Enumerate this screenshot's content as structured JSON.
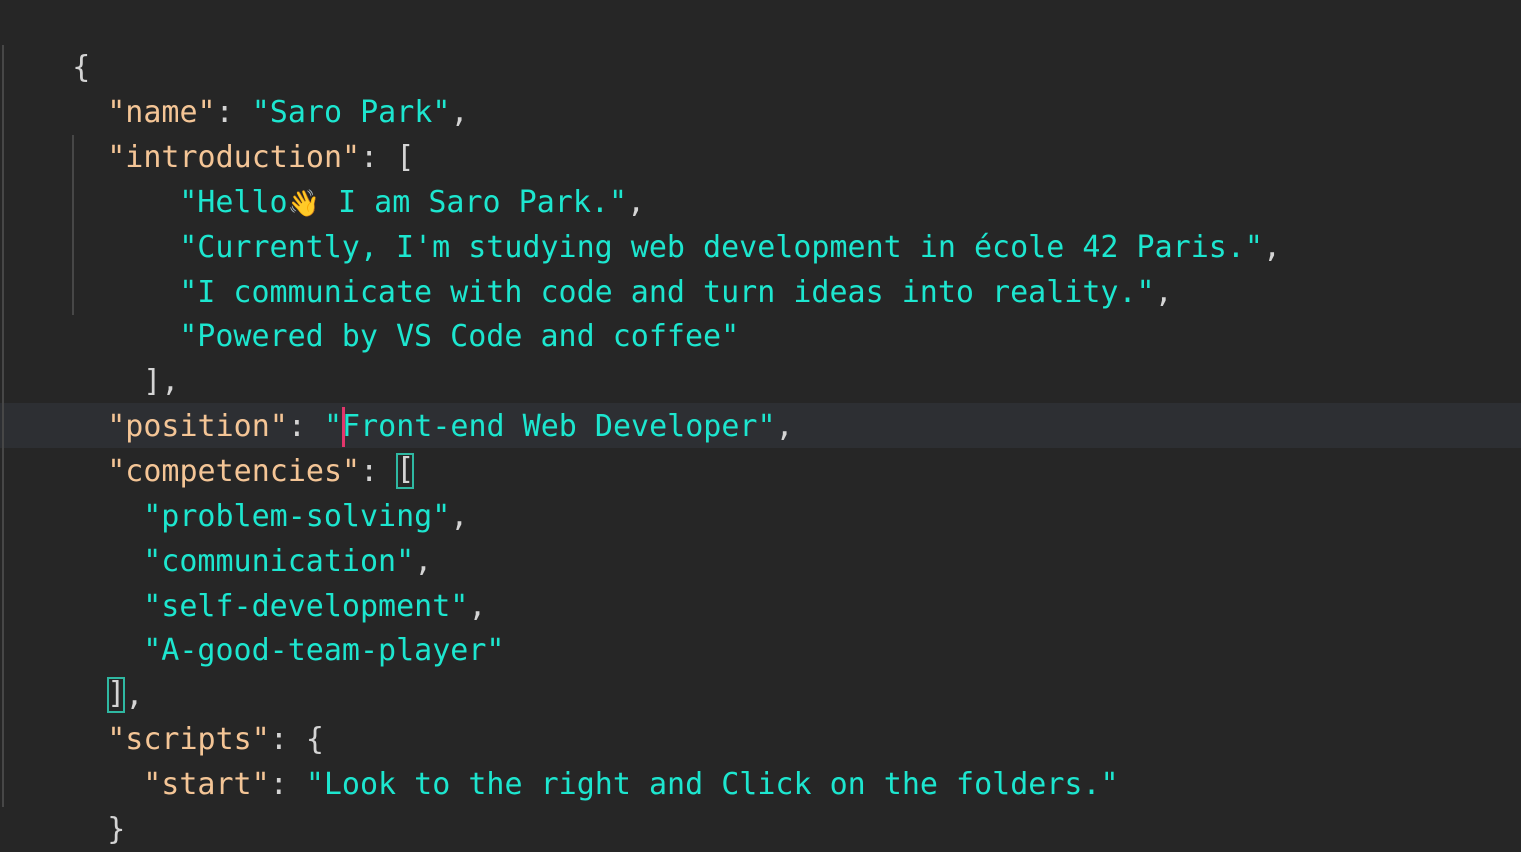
{
  "editor": {
    "lines": {
      "open_brace": "{",
      "name_key": "\"name\"",
      "name_colon": ": ",
      "name_value": "\"Saro Park\"",
      "name_comma": ",",
      "intro_key": "\"introduction\"",
      "intro_after": ": [",
      "intro_1_pre": "\"Hello",
      "intro_1_emoji": "👋",
      "intro_1_post": " I am Saro Park.\"",
      "intro_1_comma": ",",
      "intro_2": "\"Currently, I'm studying web development in école 42 Paris.\"",
      "intro_2_comma": ",",
      "intro_3": "\"I communicate with code and turn ideas into reality.\"",
      "intro_3_comma": ",",
      "intro_4": "\"Powered by VS Code and coffee\"",
      "intro_close": "],",
      "position_key": "\"position\"",
      "position_colon": ": ",
      "position_value": "\"Front-end Web Developer\"",
      "position_comma": ",",
      "competencies_key": "\"competencies\"",
      "competencies_colon": ": ",
      "competencies_open": "[",
      "comp_1": "\"problem-solving\"",
      "comp_1_comma": ",",
      "comp_2": "\"communication\"",
      "comp_2_comma": ",",
      "comp_3": "\"self-development\"",
      "comp_3_comma": ",",
      "comp_4": "\"A-good-team-player\"",
      "competencies_close": "]",
      "competencies_close_comma": ",",
      "scripts_key": "\"scripts\"",
      "scripts_after": ": {",
      "start_key": "\"start\"",
      "start_colon": ": ",
      "start_value": "\"Look to the right and Click on the folders.\"",
      "scripts_close": "}",
      "close_brace": "}"
    },
    "colors": {
      "background": "#262626",
      "key": "#f4c596",
      "string": "#1de6cf",
      "punctuation": "#d4d4d4",
      "caret": "#e3366b",
      "bracket_match": "#2fb8a2"
    }
  }
}
